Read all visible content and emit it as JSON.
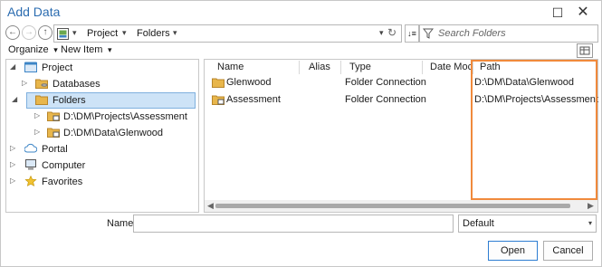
{
  "dialog": {
    "title": "Add Data",
    "maximize_glyph": "☐",
    "close_glyph": "✕"
  },
  "nav": {
    "back_glyph": "←",
    "forward_glyph": "→",
    "up_glyph": "↑",
    "breadcrumb": [
      "Project",
      "Folders"
    ],
    "search_placeholder": "Search Folders",
    "sort_glyph": "↓≡"
  },
  "toolbar": {
    "organize_label": "Organize",
    "new_item_label": "New Item"
  },
  "tree": {
    "items": [
      {
        "label": "Project",
        "expanded": true,
        "icon": "project-icon"
      },
      {
        "label": "Databases",
        "expanded": false,
        "icon": "databases-icon"
      },
      {
        "label": "Folders",
        "expanded": true,
        "icon": "folders-icon",
        "selected": true
      },
      {
        "label": "D:\\DM\\Projects\\Assessment",
        "expanded": false,
        "icon": "folder-connection-icon"
      },
      {
        "label": "D:\\DM\\Data\\Glenwood",
        "expanded": false,
        "icon": "folder-connection-icon"
      },
      {
        "label": "Portal",
        "expanded": false,
        "icon": "cloud-icon"
      },
      {
        "label": "Computer",
        "expanded": false,
        "icon": "computer-icon"
      },
      {
        "label": "Favorites",
        "expanded": false,
        "icon": "star-icon"
      }
    ]
  },
  "list": {
    "columns": [
      "Name",
      "Alias",
      "Type",
      "Date Moc",
      "Path"
    ],
    "rows": [
      {
        "name": "Glenwood",
        "alias": "",
        "type": "Folder Connection",
        "date": "",
        "path": "D:\\DM\\Data\\Glenwood"
      },
      {
        "name": "Assessment",
        "alias": "",
        "type": "Folder Connection",
        "date": "",
        "path": "D:\\DM\\Projects\\Assessment"
      }
    ]
  },
  "footer": {
    "name_label": "Name",
    "name_value": "",
    "filter_value": "Default",
    "open_label": "Open",
    "cancel_label": "Cancel"
  },
  "colors": {
    "title": "#2b6cb0",
    "selection": "#cde3f7",
    "highlight_box": "#f08a3c",
    "folder": "#e8b64b"
  }
}
